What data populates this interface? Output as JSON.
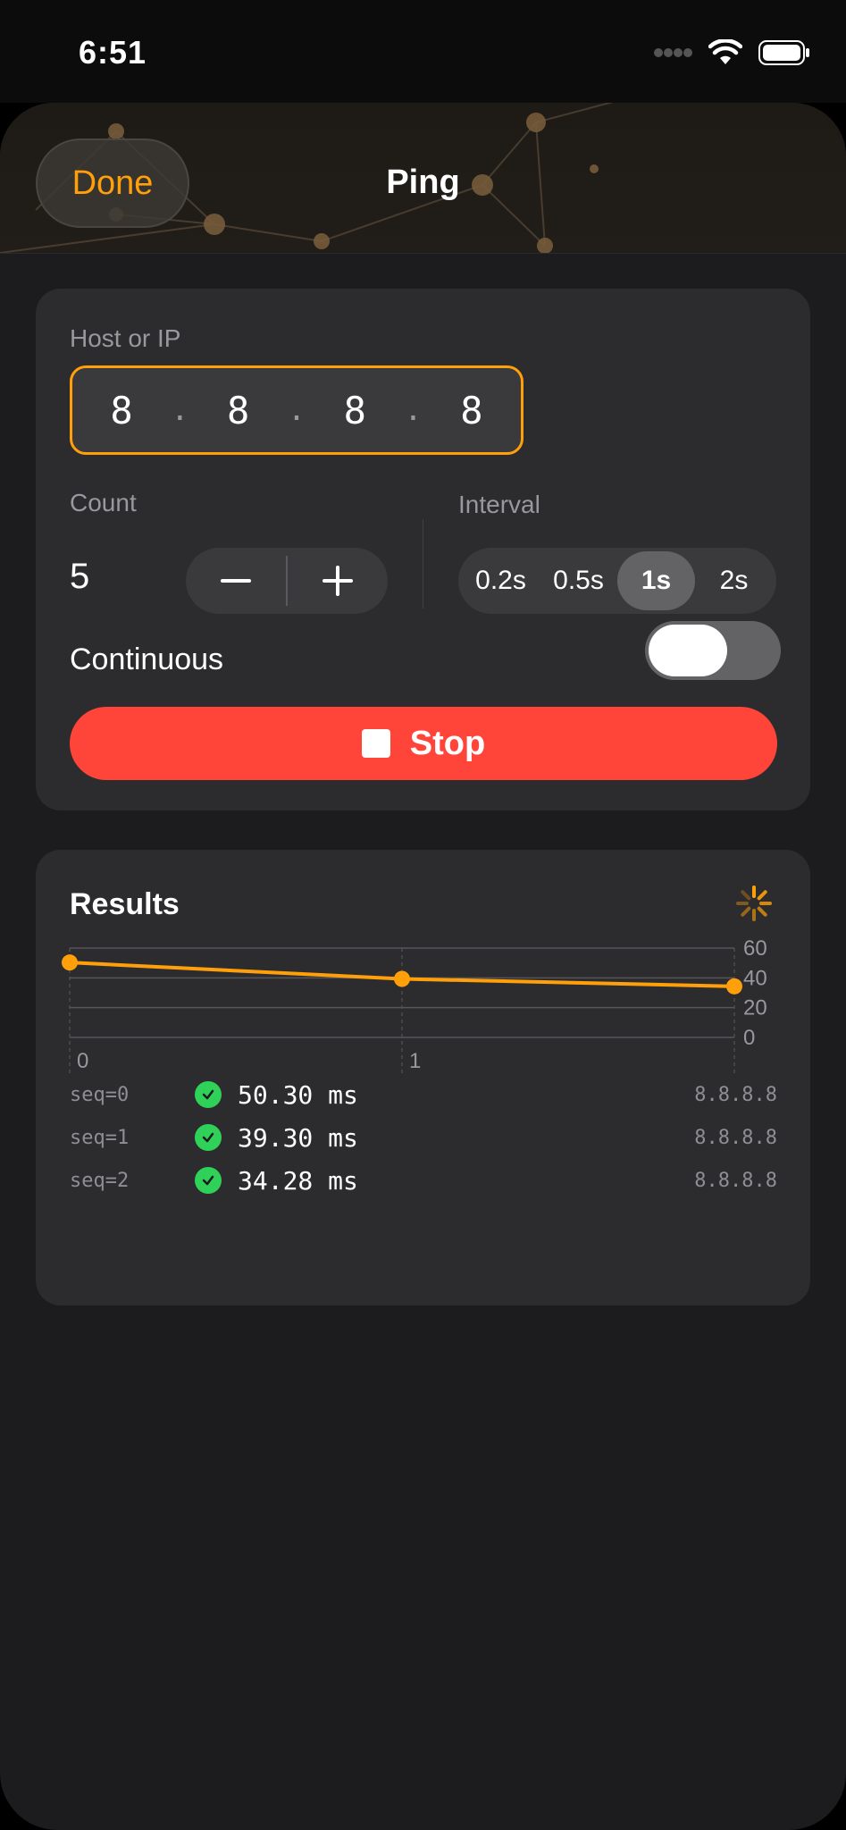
{
  "status_bar": {
    "time": "6:51"
  },
  "header": {
    "done_label": "Done",
    "title": "Ping"
  },
  "form": {
    "host_label": "Host or IP",
    "ip_octets": [
      "8",
      "8",
      "8",
      "8"
    ],
    "ip_separator": ".",
    "count_label": "Count",
    "count_value": "5",
    "interval_label": "Interval",
    "interval_options": [
      "0.2s",
      "0.5s",
      "1s",
      "2s"
    ],
    "interval_selected": "1s",
    "continuous_label": "Continuous",
    "continuous_on": false,
    "stop_label": "Stop"
  },
  "results": {
    "title": "Results",
    "rows": [
      {
        "seq": "seq=0",
        "time": "50.30 ms",
        "host": "8.8.8.8"
      },
      {
        "seq": "seq=1",
        "time": "39.30 ms",
        "host": "8.8.8.8"
      },
      {
        "seq": "seq=2",
        "time": "34.28 ms",
        "host": "8.8.8.8"
      }
    ]
  },
  "chart_data": {
    "type": "line",
    "x": [
      0,
      1,
      2
    ],
    "values": [
      50.3,
      39.3,
      34.28
    ],
    "x_tick_labels": [
      "0",
      "1"
    ],
    "y_ticks": [
      60,
      40,
      20,
      0
    ],
    "ylabel": "ms",
    "ylim": [
      0,
      60
    ],
    "color": "#ff9f0a"
  },
  "colors": {
    "accent": "#ff9f0a",
    "stop": "#ff453a",
    "success": "#30d158",
    "card": "#2c2c2e"
  }
}
